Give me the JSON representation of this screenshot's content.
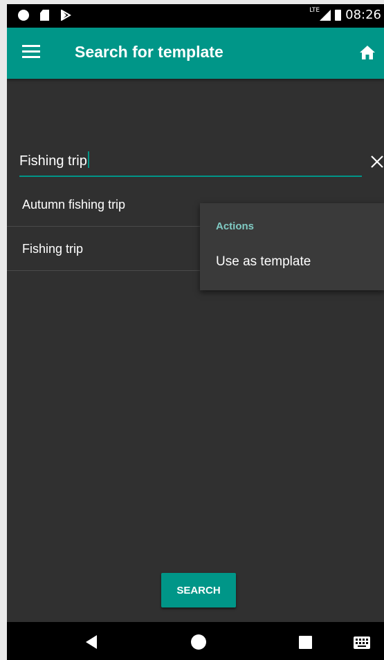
{
  "status_bar": {
    "network_label": "LTE",
    "time": "08:26",
    "icons": [
      "record-dot-icon",
      "sd-card-icon",
      "play-store-icon",
      "signal-icon",
      "battery-icon"
    ]
  },
  "app_bar": {
    "title": "Search for template",
    "menu_icon": "hamburger-menu-icon",
    "home_icon": "home-icon"
  },
  "search": {
    "value": "Fishing trip",
    "clear_icon": "close-icon"
  },
  "results": [
    {
      "label": "Autumn fishing trip"
    },
    {
      "label": "Fishing trip"
    }
  ],
  "popup_menu": {
    "header": "Actions",
    "items": [
      {
        "label": "Use as template"
      }
    ]
  },
  "search_button_label": "SEARCH",
  "nav_bar": {
    "icons": [
      "back-icon",
      "home-circle-icon",
      "recents-icon",
      "keyboard-icon"
    ]
  },
  "colors": {
    "accent": "#009688",
    "background": "#303030",
    "popup_header": "#80cbc4",
    "popup_background": "#3a3a3a"
  }
}
